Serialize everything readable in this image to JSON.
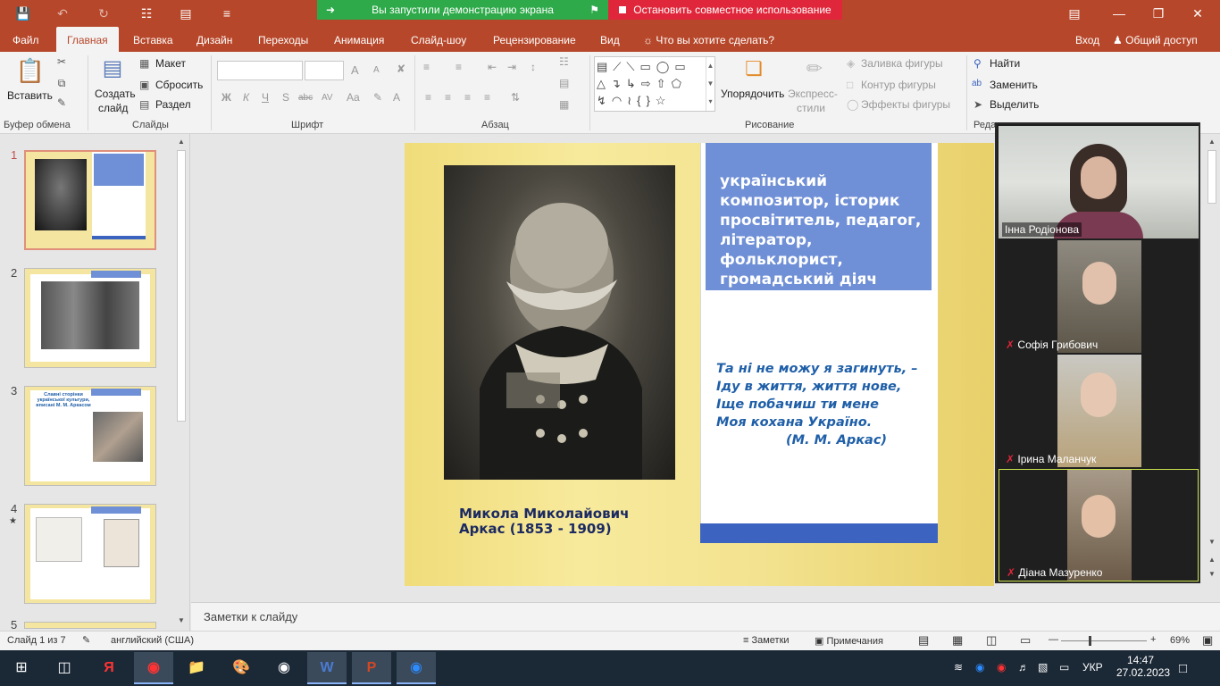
{
  "titlebar": {
    "banner_green": "Вы запустили демонстрацию экрана",
    "banner_red": "Остановить совместное использование"
  },
  "tabs": {
    "file": "Файл",
    "home": "Главная",
    "insert": "Вставка",
    "design": "Дизайн",
    "transitions": "Переходы",
    "animation": "Анимация",
    "slideshow": "Слайд-шоу",
    "review": "Рецензирование",
    "view": "Вид",
    "tell_me": "Что вы хотите сделать?",
    "signin": "Вход",
    "share": "Общий доступ"
  },
  "ribbon": {
    "clipboard": {
      "paste": "Вставить",
      "label": "Буфер обмена"
    },
    "slides": {
      "new_slide_1": "Создать",
      "new_slide_2": "слайд",
      "layout": "Макет",
      "reset": "Сбросить",
      "section": "Раздел",
      "label": "Слайды"
    },
    "font": {
      "bold": "Ж",
      "italic": "К",
      "underline": "Ч",
      "strike": "S",
      "abc": "abc",
      "spacing": "AV",
      "case": "Aa",
      "grow": "A",
      "shrink": "A",
      "label": "Шрифт"
    },
    "paragraph": {
      "label": "Абзац"
    },
    "drawing": {
      "arrange_1": "Упорядочить",
      "quick_styles_1": "Экспресс-",
      "quick_styles_2": "стили",
      "fill": "Заливка фигуры",
      "outline": "Контур фигуры",
      "effects": "Эффекты фигуры",
      "label": "Рисование"
    },
    "editing": {
      "find": "Найти",
      "replace": "Заменить",
      "select": "Выделить",
      "label": "Реда"
    }
  },
  "thumbs": [
    {
      "num": "1"
    },
    {
      "num": "2"
    },
    {
      "num": "3",
      "title": "Славні сторінки української культури, вписані М. М. Аркасом"
    },
    {
      "num": "4",
      "star": "★"
    },
    {
      "num": "5"
    }
  ],
  "slide": {
    "roles_line1": "український",
    "roles_line2": "композитор, історик",
    "roles_line3": "просвітитель, педагог,",
    "roles_line4": "літератор,",
    "roles_line5": "фольклорист,",
    "roles_line6": "громадський діяч",
    "quote_line1": "Та ні не можу я загинуть, –",
    "quote_line2": "Іду в життя, життя нове,",
    "quote_line3": "Іще побачиш ти мене",
    "quote_line4": "Моя кохана Україно.",
    "quote_author": "(М. М. Аркас)",
    "caption_line1": "Микола Миколайович",
    "caption_line2": "Аркас (1853 - 1909)"
  },
  "participants": [
    {
      "name": "Інна Родіонова"
    },
    {
      "name": "Софія Грибович"
    },
    {
      "name": "Ірина Маланчук"
    },
    {
      "name": "Діана Мазуренко"
    }
  ],
  "notes_placeholder": "Заметки к слайду",
  "status": {
    "slide_info": "Слайд 1 из 7",
    "language": "английский (США)",
    "notes": "Заметки",
    "comments": "Примечания",
    "zoom": "69%"
  },
  "taskbar": {
    "lang": "УКР",
    "time": "14:47",
    "date": "27.02.2023"
  },
  "colors": {
    "accent": "#b7472a",
    "banner_green": "#2eaa4a",
    "banner_red": "#e0263a",
    "slide_blue": "#6f8fd6"
  }
}
